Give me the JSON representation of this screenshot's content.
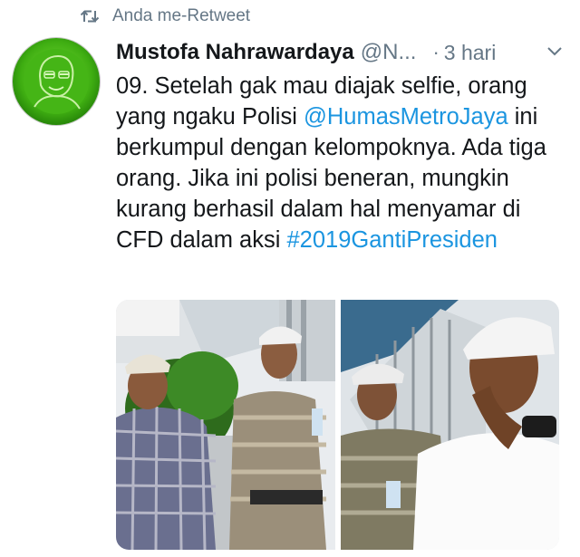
{
  "retweet": {
    "icon": "retweet-icon",
    "label": "Anda me-Retweet"
  },
  "tweet": {
    "avatar_icon": "profile-avatar",
    "display_name": "Mustofa Nahrawardaya",
    "handle": "@N...",
    "separator": "·",
    "time": "3 hari",
    "menu_icon": "chevron-down-icon",
    "text": {
      "part1": "09. Setelah gak mau diajak selfie, orang yang ngaku Polisi ",
      "mention": "@HumasMetroJaya",
      "part2": " ini berkumpul dengan kelompoknya. Ada tiga orang. Jika ini polisi beneran, mungkin kurang berhasil dalam hal menyamar di CFD dalam aksi ",
      "hashtag": "#2019GantiPresiden"
    },
    "media": {
      "count": 2
    }
  },
  "colors": {
    "link": "#1b95e0",
    "secondary_text": "#657786",
    "primary_text": "#14171a",
    "avatar_green": "#3fae12"
  }
}
